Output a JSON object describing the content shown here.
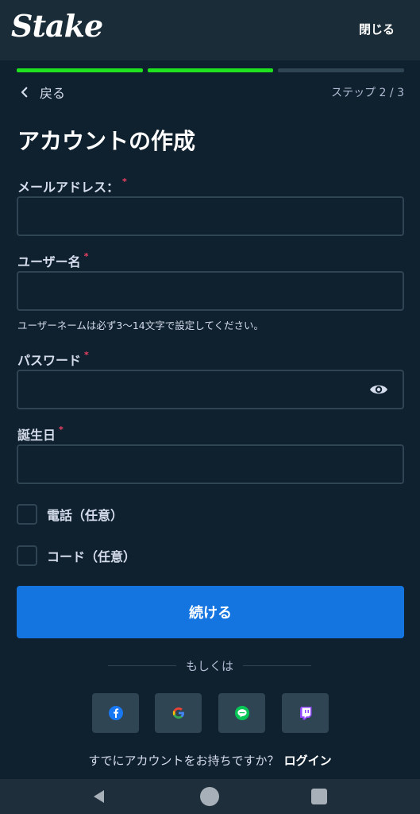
{
  "header": {
    "logo": "Stake",
    "close_label": "閉じる"
  },
  "progress": {
    "current_step": 2,
    "total_steps": 3
  },
  "nav": {
    "back_label": "戻る",
    "step_label": "ステップ 2 / 3"
  },
  "title": "アカウントの作成",
  "form": {
    "email": {
      "label": "メールアドレス：",
      "required": "*",
      "value": ""
    },
    "username": {
      "label": "ユーザー名",
      "required": "*",
      "value": "",
      "hint": "ユーザーネームは必ず3〜14文字で設定してください。"
    },
    "password": {
      "label": "パスワード",
      "required": "*",
      "value": ""
    },
    "birthday": {
      "label": "誕生日",
      "required": "*",
      "value": ""
    },
    "phone_optional": {
      "label": "電話（任意）",
      "checked": false
    },
    "code_optional": {
      "label": "コード（任意）",
      "checked": false
    }
  },
  "continue_label": "続ける",
  "divider_text": "もしくは",
  "social_icons": [
    "facebook-icon",
    "google-icon",
    "line-icon",
    "twitch-icon"
  ],
  "footer": {
    "prompt": "すでにアカウントをお持ちですか？",
    "login_label": "ログイン"
  },
  "colors": {
    "background": "#0f212e",
    "header": "#1a2c38",
    "accent_blue": "#1475e1",
    "progress_green": "#1fe11f",
    "border": "#2f4553",
    "required_red": "#ed4163"
  }
}
